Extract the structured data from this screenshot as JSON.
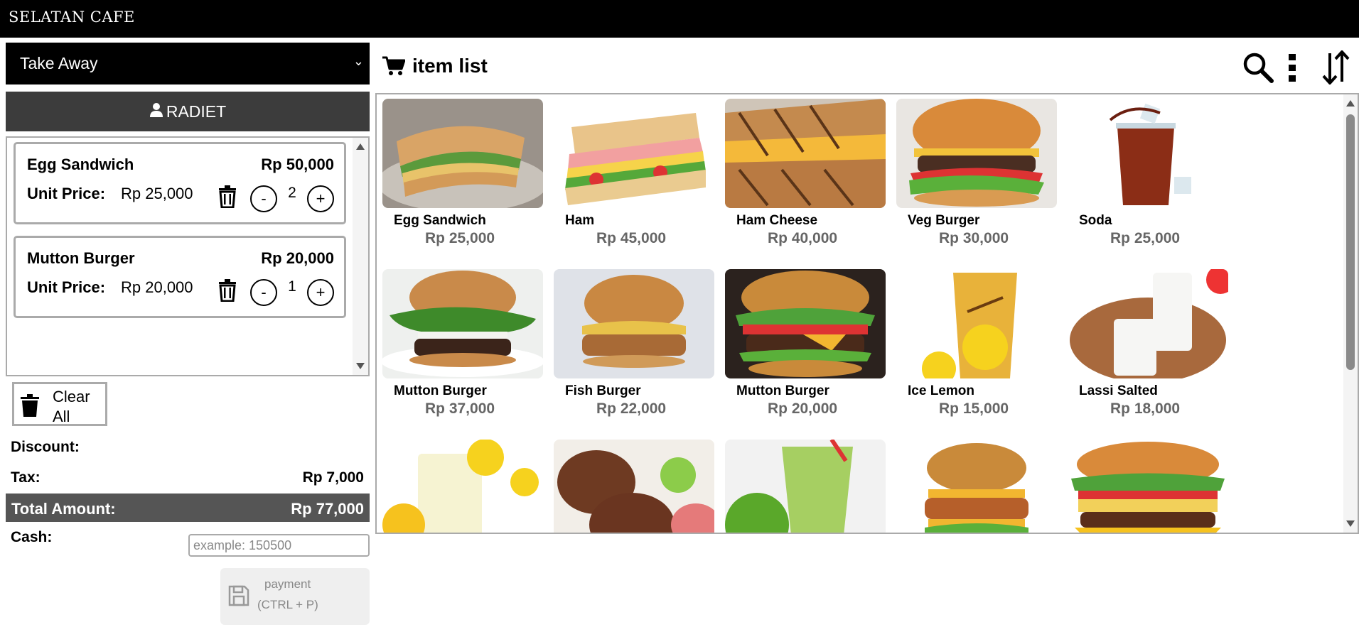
{
  "app": {
    "title": "SELATAN CAFE"
  },
  "order": {
    "type": "Take Away",
    "customer": "RADIET"
  },
  "cart": {
    "unit_price_label": "Unit Price:",
    "items": [
      {
        "name": "Egg Sandwich",
        "total": "Rp 50,000",
        "unit_price": "Rp 25,000",
        "qty": "2",
        "minus": "-",
        "plus": "+"
      },
      {
        "name": "Mutton Burger",
        "total": "Rp 20,000",
        "unit_price": "Rp 20,000",
        "qty": "1",
        "minus": "-",
        "plus": "+"
      }
    ]
  },
  "actions": {
    "clear_all": "Clear All"
  },
  "summary": {
    "discount_label": "Discount:",
    "tax_label": "Tax:",
    "tax_value": "Rp 7,000",
    "total_label": "Total Amount:",
    "total_value": "Rp 77,000",
    "cash_label": "Cash:",
    "cash_placeholder": "example: 150500",
    "payment_label": "payment",
    "payment_shortcut": "(CTRL + P)"
  },
  "item_list": {
    "title": "item list",
    "items": [
      {
        "name": "Egg Sandwich",
        "price": "Rp 25,000",
        "image": "egg-sandwich"
      },
      {
        "name": "Ham",
        "price": "Rp 45,000",
        "image": "ham-sandwich"
      },
      {
        "name": "Ham Cheese",
        "price": "Rp 40,000",
        "image": "ham-cheese-panini"
      },
      {
        "name": "Veg Burger",
        "price": "Rp 30,000",
        "image": "veg-burger"
      },
      {
        "name": "Soda",
        "price": "Rp 25,000",
        "image": "soda-glass"
      },
      {
        "name": "Mutton Burger",
        "price": "Rp 37,000",
        "image": "mutton-burger-greens"
      },
      {
        "name": "Fish Burger",
        "price": "Rp 22,000",
        "image": "fish-burger"
      },
      {
        "name": "Mutton Burger",
        "price": "Rp 20,000",
        "image": "mutton-burger-cheese"
      },
      {
        "name": "Ice Lemon",
        "price": "Rp 15,000",
        "image": "ice-lemon"
      },
      {
        "name": "Lassi Salted",
        "price": "Rp 18,000",
        "image": "lassi"
      },
      {
        "name": "",
        "price": "",
        "image": "lemonade"
      },
      {
        "name": "",
        "price": "",
        "image": "meat-patties"
      },
      {
        "name": "",
        "price": "",
        "image": "green-apple-juice"
      },
      {
        "name": "",
        "price": "",
        "image": "chicken-burger"
      },
      {
        "name": "",
        "price": "",
        "image": "big-burger"
      }
    ]
  },
  "icons": {
    "brand": [],
    "cart": "cart-icon",
    "search": "search-icon",
    "more": "more-vertical-icon",
    "sort": "sort-icon",
    "user": "user-icon",
    "trash": "trash-icon",
    "save": "save-icon"
  }
}
